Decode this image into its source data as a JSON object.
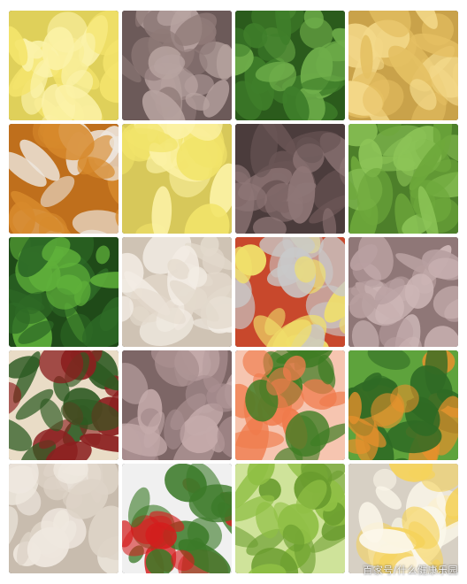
{
  "collage": {
    "description_tiles": [
      {
        "name": "napa-cabbage-tile",
        "palette": [
          "#f4e46c",
          "#fbf2a8",
          "#dfd05a"
        ]
      },
      {
        "name": "sliced-beef-tile",
        "palette": [
          "#8f7a78",
          "#b7a3a0",
          "#6c5a59"
        ]
      },
      {
        "name": "leafy-greens-tile",
        "palette": [
          "#3f7e2a",
          "#6fae4a",
          "#2b5b1c"
        ]
      },
      {
        "name": "corn-tile",
        "palette": [
          "#f3d889",
          "#e5c063",
          "#c9a24a"
        ]
      },
      {
        "name": "tofu-pumpkin-tile",
        "palette": [
          "#ede6de",
          "#d78a2c",
          "#bf6f1c"
        ]
      },
      {
        "name": "cabbage-bowl-tile",
        "palette": [
          "#f2e46a",
          "#fbf1a4",
          "#d7c85a"
        ]
      },
      {
        "name": "beef-chunks-tile",
        "palette": [
          "#6a5555",
          "#8e7676",
          "#4b3c3c"
        ]
      },
      {
        "name": "snow-peas-tile",
        "palette": [
          "#6ea83b",
          "#8cc457",
          "#4d7f2a"
        ]
      },
      {
        "name": "spinach-pepper-tile",
        "palette": [
          "#2e6a26",
          "#5fb03a",
          "#1f4a18"
        ]
      },
      {
        "name": "chicken-breast-tile",
        "palette": [
          "#f2ece4",
          "#e3d9cc",
          "#cfc3b4"
        ]
      },
      {
        "name": "bento-tray-tile",
        "palette": [
          "#c9c9c9",
          "#f0e06b",
          "#c8482c"
        ]
      },
      {
        "name": "beef-slices-tile",
        "palette": [
          "#b89fa0",
          "#cdb6b6",
          "#8f7777"
        ]
      },
      {
        "name": "spinach-dates-tile",
        "palette": [
          "#2d5a22",
          "#8b1f1f",
          "#e9dcc6"
        ]
      },
      {
        "name": "beef-plate-tile",
        "palette": [
          "#a98f90",
          "#c4aaaa",
          "#7d6666"
        ]
      },
      {
        "name": "shrimp-broccoli-tile",
        "palette": [
          "#f07b4b",
          "#3f7d24",
          "#f6c5b0"
        ]
      },
      {
        "name": "greens-pumpkin-tile",
        "palette": [
          "#2f6a24",
          "#e8902c",
          "#5ea33c"
        ]
      },
      {
        "name": "shredded-chicken-tile",
        "palette": [
          "#efe8df",
          "#ddd3c7",
          "#c8bcae"
        ]
      },
      {
        "name": "tomato-salad-tile",
        "palette": [
          "#d41d1d",
          "#3b7a28",
          "#f0f0f0"
        ]
      },
      {
        "name": "broccoli-tile",
        "palette": [
          "#6a9c2e",
          "#8fbf44",
          "#cfe39a"
        ]
      },
      {
        "name": "egg-chicken-tile",
        "palette": [
          "#fbf7ea",
          "#f5d25c",
          "#d7d0c4"
        ]
      }
    ],
    "watermark": "百家号/什么健康乐园"
  }
}
